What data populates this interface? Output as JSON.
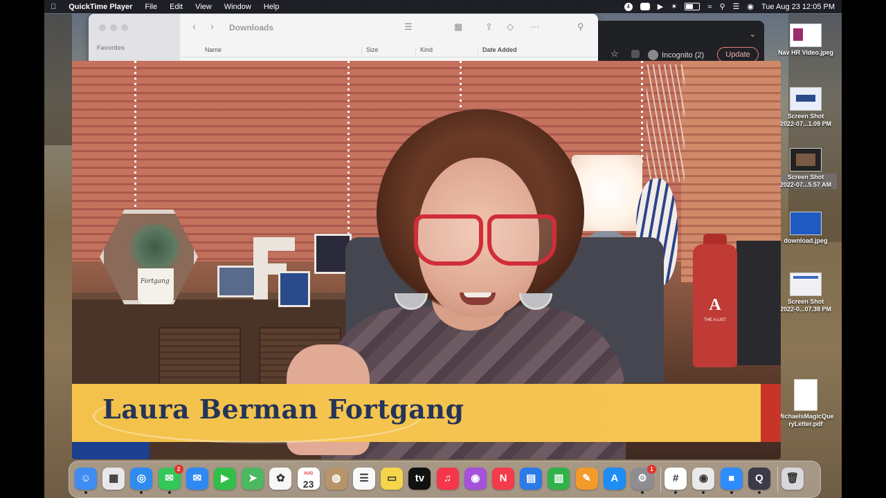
{
  "menubar": {
    "app_name": "QuickTime Player",
    "menus": [
      "File",
      "Edit",
      "View",
      "Window",
      "Help"
    ],
    "notification_count": "4",
    "datetime": "Tue Aug 23  12:05 PM"
  },
  "finder": {
    "title": "Downloads",
    "sidebar_heading": "Favorites",
    "columns": [
      "Name",
      "Size",
      "Kind",
      "Date Added"
    ]
  },
  "chrome": {
    "profile": "Incognito (2)",
    "update_label": "Update"
  },
  "desktop_icons": [
    {
      "line1": "Nav HR Video.jpeg",
      "line2": ""
    },
    {
      "line1": "Screen Shot",
      "line2": "2022-07...1.09 PM"
    },
    {
      "line1": "Screen Shot",
      "line2": "2022-07...5.57 AM"
    },
    {
      "line1": "download.jpeg",
      "line2": ""
    },
    {
      "line1": "Screen Shot",
      "line2": "2022-0...07.38 PM"
    },
    {
      "line1": "MichaelsMagicQue",
      "line2": "ryLetter.pdf"
    }
  ],
  "video": {
    "lower_third_name": "Laura Berman Fortgang",
    "bottle_logo": "A",
    "bottle_caption": "THE A-LIST",
    "pot_label": "Fortgang"
  },
  "dock": {
    "apps": [
      {
        "name": "Finder",
        "glyph": "☺",
        "color": "#3f8cf2"
      },
      {
        "name": "Launchpad",
        "glyph": "▦",
        "color": "#e8e8ec"
      },
      {
        "name": "Safari",
        "glyph": "◎",
        "color": "#2f8bf0"
      },
      {
        "name": "Messages",
        "glyph": "✉",
        "color": "#34c759",
        "badge": "2"
      },
      {
        "name": "Mail",
        "glyph": "✉",
        "color": "#2f89f5"
      },
      {
        "name": "FaceTime",
        "glyph": "▶",
        "color": "#30c048"
      },
      {
        "name": "Maps",
        "glyph": "➤",
        "color": "#4cb860"
      },
      {
        "name": "Photos",
        "glyph": "✿",
        "color": "#f6f6f6"
      },
      {
        "name": "Calendar",
        "glyph": "23",
        "month": "AUG",
        "color": "#ffffff"
      },
      {
        "name": "Contacts",
        "glyph": "◍",
        "color": "#b8946a"
      },
      {
        "name": "Reminders",
        "glyph": "☰",
        "color": "#f8f8f8"
      },
      {
        "name": "Notes",
        "glyph": "▭",
        "color": "#f7d54a"
      },
      {
        "name": "TV",
        "glyph": "tv",
        "color": "#111111"
      },
      {
        "name": "Music",
        "glyph": "♫",
        "color": "#f5374a"
      },
      {
        "name": "Podcasts",
        "glyph": "◉",
        "color": "#a352d9"
      },
      {
        "name": "News",
        "glyph": "N",
        "color": "#f43b4b"
      },
      {
        "name": "Keynote",
        "glyph": "▤",
        "color": "#2a7ae8"
      },
      {
        "name": "Numbers",
        "glyph": "▥",
        "color": "#30b24a"
      },
      {
        "name": "Pages",
        "glyph": "✎",
        "color": "#f29a2a"
      },
      {
        "name": "App Store",
        "glyph": "A",
        "color": "#1e8cf5"
      },
      {
        "name": "System Preferences",
        "glyph": "⚙",
        "color": "#8d8d92",
        "badge": "1"
      },
      {
        "name": "Slack",
        "glyph": "#",
        "color": "#ffffff"
      },
      {
        "name": "Chrome",
        "glyph": "◉",
        "color": "#e9e9e9"
      },
      {
        "name": "Zoom",
        "glyph": "■",
        "color": "#2d8cff"
      },
      {
        "name": "QuickTime Player",
        "glyph": "Q",
        "color": "#3a3a48"
      },
      {
        "name": "Trash",
        "glyph": "🗑",
        "color": "#d8d8dc"
      }
    ]
  },
  "colors": {
    "lower_third_yellow": "#f3c24a",
    "lower_third_text": "#253459",
    "lower_third_red": "#c63528",
    "lower_third_blue": "#1c3f8e",
    "glasses_red": "#d02d38"
  }
}
